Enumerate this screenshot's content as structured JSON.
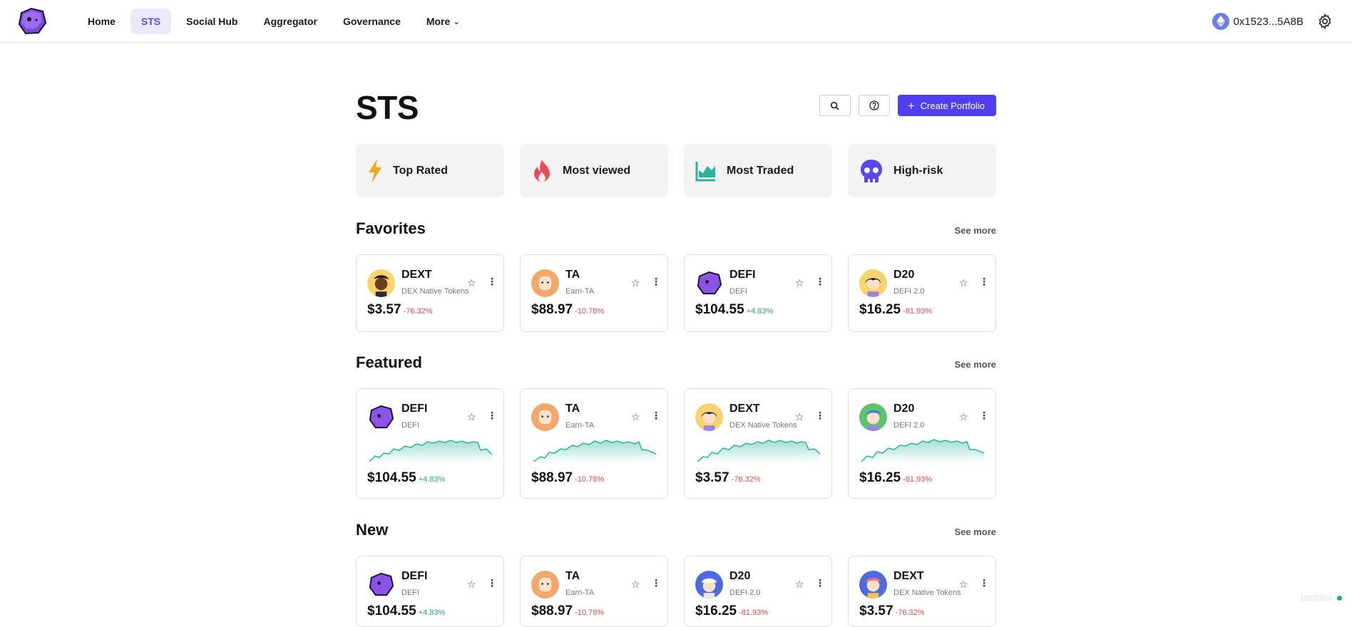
{
  "nav": {
    "items": [
      {
        "label": "Home"
      },
      {
        "label": "STS"
      },
      {
        "label": "Social Hub"
      },
      {
        "label": "Aggregator"
      },
      {
        "label": "Governance"
      },
      {
        "label": "More"
      }
    ],
    "wallet": "0x1523...5A8B"
  },
  "page": {
    "title": "STS",
    "create_label": "Create Portfolio"
  },
  "categories": [
    {
      "label": "Top Rated",
      "icon": "lightning-icon",
      "color": "#f4a51c"
    },
    {
      "label": "Most viewed",
      "icon": "flame-icon",
      "color": "#ee4a5c"
    },
    {
      "label": "Most Traded",
      "icon": "chart-icon",
      "color": "#2bb39c"
    },
    {
      "label": "High-risk",
      "icon": "skull-icon",
      "color": "#5b47f0"
    }
  ],
  "sections": {
    "favorites": {
      "title": "Favorites",
      "see_more": "See more",
      "cards": [
        {
          "name": "DEXT",
          "sub": "DEX Native Tokens",
          "price": "$3.57",
          "change": "-76.32%"
        },
        {
          "name": "TA",
          "sub": "Earn-TA",
          "price": "$88.97",
          "change": "-10.78%"
        },
        {
          "name": "DEFI",
          "sub": "DEFI",
          "price": "$104.55",
          "change": "+4.83%"
        },
        {
          "name": "D20",
          "sub": "DEFI 2.0",
          "price": "$16.25",
          "change": "-81.93%"
        }
      ]
    },
    "featured": {
      "title": "Featured",
      "see_more": "See more",
      "cards": [
        {
          "name": "DEFI",
          "sub": "DEFI",
          "price": "$104.55",
          "change": "+4.83%"
        },
        {
          "name": "TA",
          "sub": "Earn-TA",
          "price": "$88.97",
          "change": "-10.78%"
        },
        {
          "name": "DEXT",
          "sub": "DEX Native Tokens",
          "price": "$3.57",
          "change": "-76.32%"
        },
        {
          "name": "D20",
          "sub": "DEFI 2.0",
          "price": "$16.25",
          "change": "-81.93%"
        }
      ]
    },
    "new": {
      "title": "New",
      "see_more": "See more",
      "cards": [
        {
          "name": "DEFI",
          "sub": "DEFI",
          "price": "$104.55",
          "change": "+4.83%"
        },
        {
          "name": "TA",
          "sub": "Earn-TA",
          "price": "$88.97",
          "change": "-10.78%"
        },
        {
          "name": "D20",
          "sub": "DEFI 2.0",
          "price": "$16.25",
          "change": "-81.93%"
        },
        {
          "name": "DEXT",
          "sub": "DEX Native Tokens",
          "price": "$3.57",
          "change": "-76.32%"
        }
      ]
    }
  },
  "footer": {
    "build": "15530565"
  },
  "colors": {
    "accent": "#4f3ff0",
    "positive": "#2aa57a",
    "negative": "#e24a4a"
  }
}
